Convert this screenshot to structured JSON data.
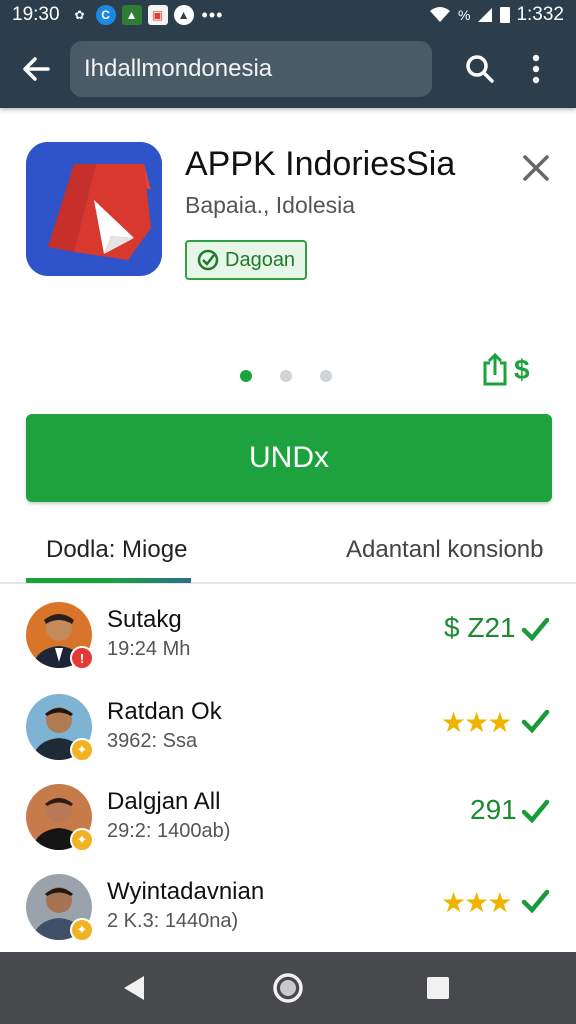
{
  "status_bar": {
    "time": "19:30",
    "right_text": "1:332",
    "signal_text": "%",
    "icons": [
      "settings-icon",
      "chat-icon",
      "gallery-icon",
      "mail-icon",
      "upload-icon",
      "more-dots-icon",
      "wifi-icon",
      "signal-icon",
      "battery-icon"
    ]
  },
  "app_bar": {
    "search_value": "Ihdallmondonesia",
    "icons": [
      "back-arrow-icon",
      "search-icon",
      "overflow-menu-icon"
    ]
  },
  "app": {
    "title": "APPK IndoriesSia",
    "subtitle": "Bapaia., Idolesia",
    "badge_label": "Dagoan",
    "install_label": "UNDx",
    "share_symbol": "$"
  },
  "tabs": [
    {
      "label": "Dodla: Mioge"
    },
    {
      "label": "Adantanl konsionb"
    }
  ],
  "list": [
    {
      "name": "Sutakg",
      "meta": "19:24 Mh",
      "value": "$ Z21",
      "rating_stars": 0,
      "badge": "!",
      "badge_color": "#e53935"
    },
    {
      "name": "Ratdan Ok",
      "meta": "3962: Ssa",
      "value": "",
      "rating_stars": 3,
      "badge": "✦",
      "badge_color": "#f2b321"
    },
    {
      "name": "Dalgjan All",
      "meta": "29:2: 1400ab)",
      "value": "291",
      "rating_stars": 0,
      "badge": "✦",
      "badge_color": "#f2b321"
    },
    {
      "name": "Wyintadavnian",
      "meta": "2 K.3: 1440na)",
      "value": "",
      "rating_stars": 3,
      "badge": "✦",
      "badge_color": "#f2b321"
    }
  ],
  "colors": {
    "bar": "#2c3e4c",
    "accent_green": "#1da23e",
    "navbar": "#47494c"
  },
  "nav_bar": {
    "icons": [
      "nav-back-icon",
      "nav-home-icon",
      "nav-recents-icon"
    ]
  }
}
